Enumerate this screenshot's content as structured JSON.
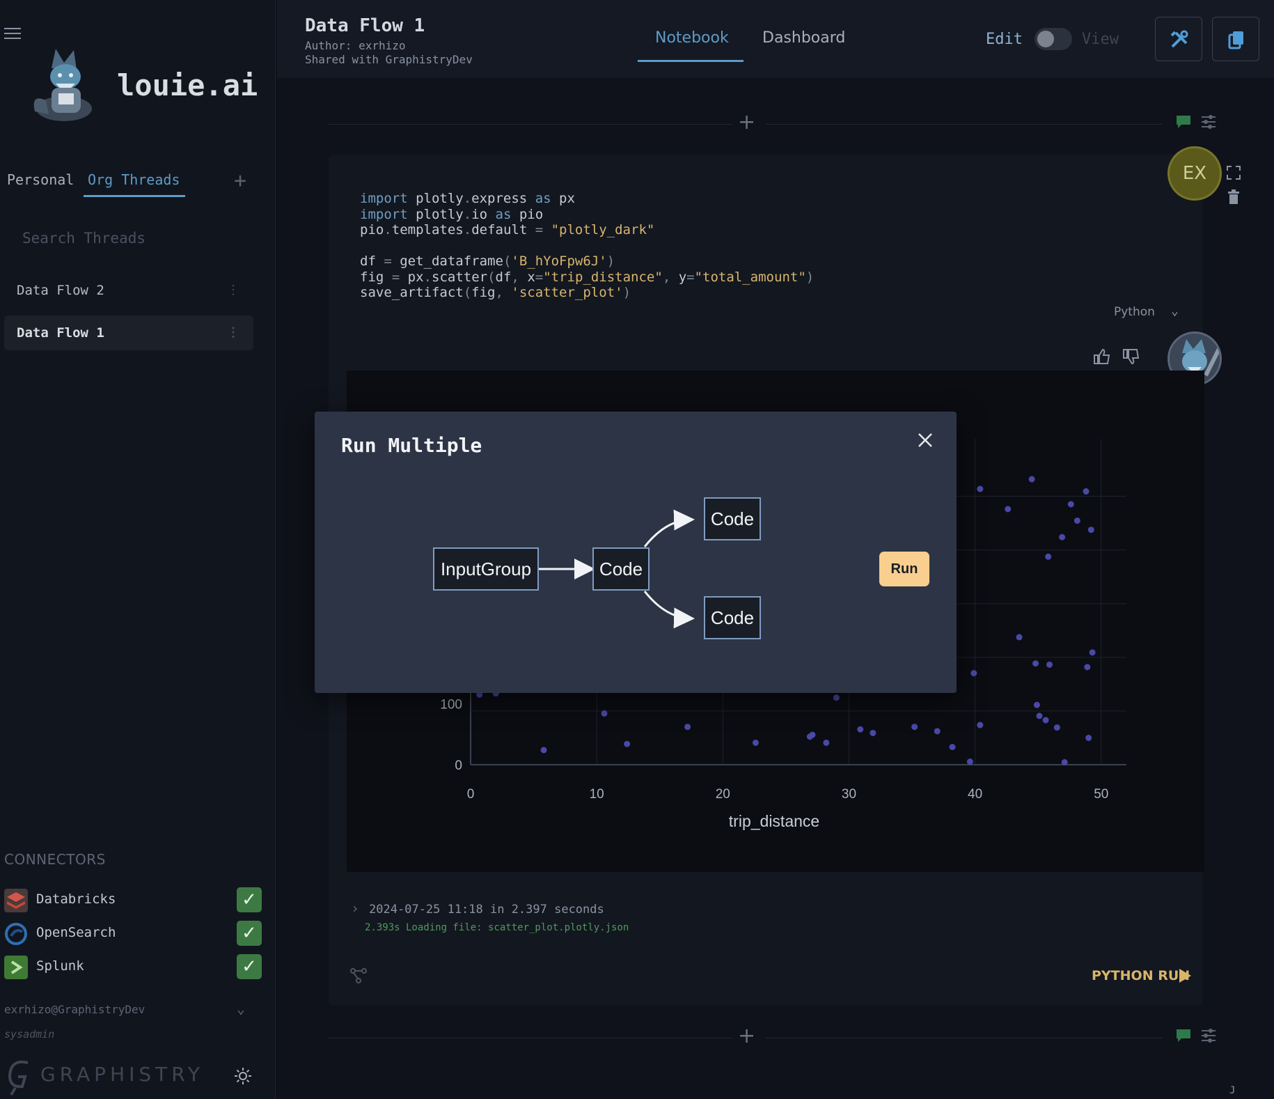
{
  "sidebar": {
    "brand": "louie.ai",
    "tabs": [
      "Personal",
      "Org Threads"
    ],
    "search_placeholder": "Search Threads",
    "threads": [
      {
        "label": "Data Flow 2"
      },
      {
        "label": "Data Flow 1"
      }
    ],
    "connectors_title": "CONNECTORS",
    "connectors": [
      {
        "label": "Databricks",
        "icon": "databricks-icon",
        "color": "#c9453a"
      },
      {
        "label": "OpenSearch",
        "icon": "opensearch-icon",
        "color": "#2f6fb4"
      },
      {
        "label": "Splunk",
        "icon": "splunk-icon",
        "color": "#4e8f3c"
      }
    ],
    "user_email": "exrhizo@GraphistryDev",
    "user_role": "sysadmin",
    "footer_brand": "GRAPHISTRY"
  },
  "header": {
    "title": "Data Flow 1",
    "author": "Author: exrhizo",
    "shared": "Shared with GraphistryDev",
    "tabs": [
      "Notebook",
      "Dashboard"
    ],
    "mode_edit": "Edit",
    "mode_view": "View"
  },
  "cell": {
    "language": "Python",
    "avatar_initials": "EX",
    "run_info": "2024-07-25 11:18 in 2.397 seconds",
    "run_log": "2.393s Loading file: scatter_plot.plotly.json",
    "python_run": "PYTHON RUN"
  },
  "chart_data": {
    "type": "scatter",
    "xlabel": "trip_distance",
    "ylabel": "",
    "x_ticks": [
      "0",
      "10",
      "20",
      "30",
      "40",
      "50"
    ],
    "y_ticks": [
      "0",
      "100"
    ],
    "xlim": [
      0,
      52
    ],
    "note_visible_range": "partially occluded by modal",
    "points": [
      [
        0.7,
        115
      ],
      [
        2,
        117
      ],
      [
        5.8,
        24
      ],
      [
        10.6,
        84
      ],
      [
        12.4,
        34
      ],
      [
        17.2,
        62
      ],
      [
        22.6,
        36
      ],
      [
        26.9,
        46
      ],
      [
        27.1,
        49
      ],
      [
        28.2,
        36
      ],
      [
        29,
        110
      ],
      [
        30.9,
        58
      ],
      [
        31.9,
        52
      ],
      [
        35.2,
        62
      ],
      [
        37,
        55
      ],
      [
        38.2,
        29
      ],
      [
        39.6,
        5
      ],
      [
        40.4,
        65
      ],
      [
        39.9,
        150
      ],
      [
        40.4,
        452
      ],
      [
        42.6,
        419
      ],
      [
        44.5,
        468
      ],
      [
        45.8,
        341
      ],
      [
        46.9,
        373
      ],
      [
        47.6,
        427
      ],
      [
        48.1,
        400
      ],
      [
        48.8,
        448
      ],
      [
        49.2,
        385
      ],
      [
        43.5,
        209
      ],
      [
        44.8,
        166
      ],
      [
        45.9,
        164
      ],
      [
        48.9,
        160
      ],
      [
        49.3,
        184
      ],
      [
        44.9,
        98
      ],
      [
        45.1,
        80
      ],
      [
        45.6,
        73
      ],
      [
        46.5,
        61
      ],
      [
        47.1,
        4
      ],
      [
        49,
        44
      ]
    ]
  },
  "modal": {
    "title": "Run Multiple",
    "nodes": [
      "InputGroup",
      "Code",
      "Code",
      "Code"
    ],
    "run_label": "Run"
  },
  "page_marker": "J"
}
